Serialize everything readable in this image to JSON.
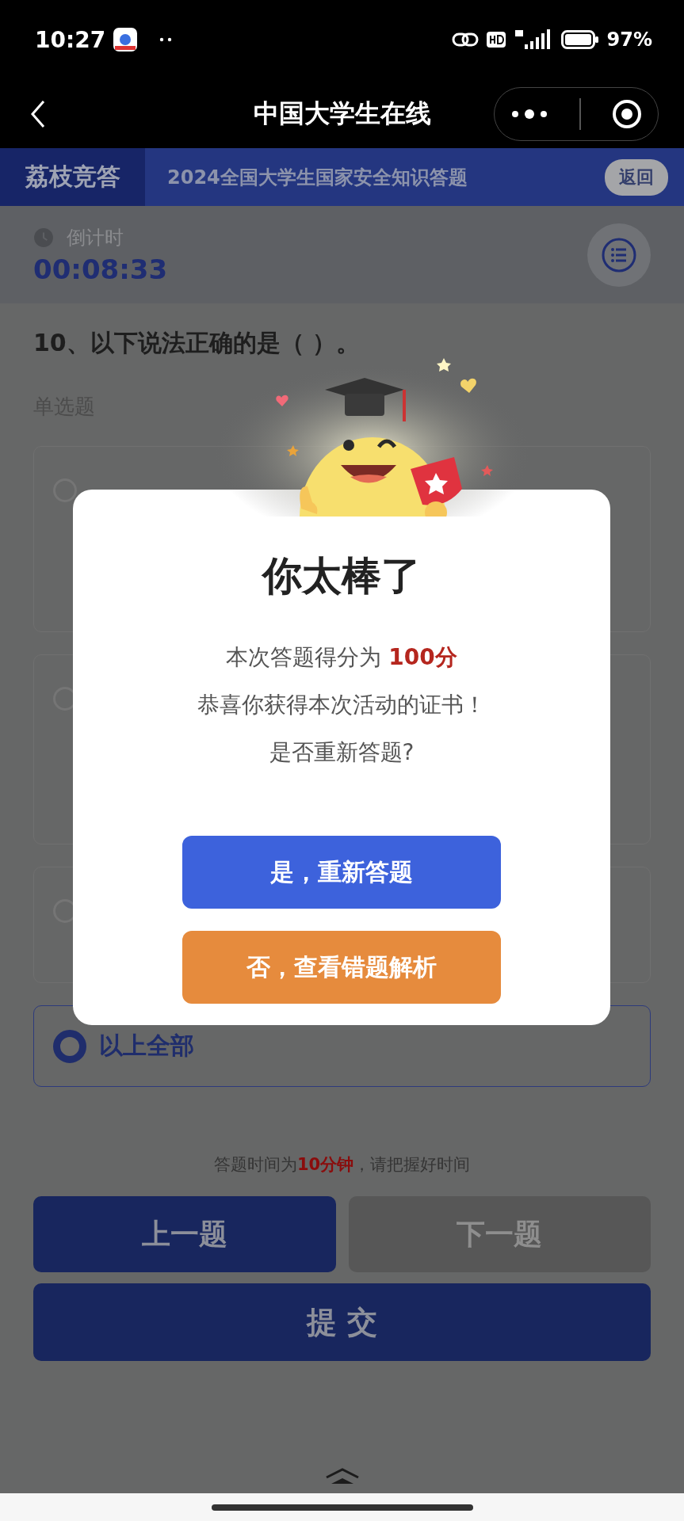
{
  "status_bar": {
    "time": "10:27",
    "battery": "97%"
  },
  "nav": {
    "title": "中国大学生在线"
  },
  "banner": {
    "brand": "荔枝竞答",
    "title": "2024全国大学生国家安全知识答题",
    "back_button": "返回"
  },
  "timer": {
    "label": "倒计时",
    "value": "00:08:33"
  },
  "question": {
    "text": "10、以下说法正确的是（ ）。",
    "type": "单选题"
  },
  "options": [
    {
      "selected": false
    },
    {
      "selected": false
    },
    {
      "selected": false
    },
    {
      "label": "以上全部",
      "selected": true
    }
  ],
  "notice": "答题时间为**10分钟**，请把握好时间",
  "step_buttons": [
    {
      "label": "上一题",
      "disabled": false
    },
    {
      "label": "下一题",
      "disabled": true
    }
  ],
  "submit_button": "提 交",
  "dialog": {
    "title": "你太棒了",
    "lines": [
      "本次答题得分为 **100分**",
      "恭喜你获得本次活动的证书！",
      "是否重新答题?"
    ],
    "buttons": [
      {
        "label": "是，重新答题",
        "kind": "primary"
      },
      {
        "label": "否，查看错题解析",
        "kind": "secondary"
      }
    ]
  }
}
